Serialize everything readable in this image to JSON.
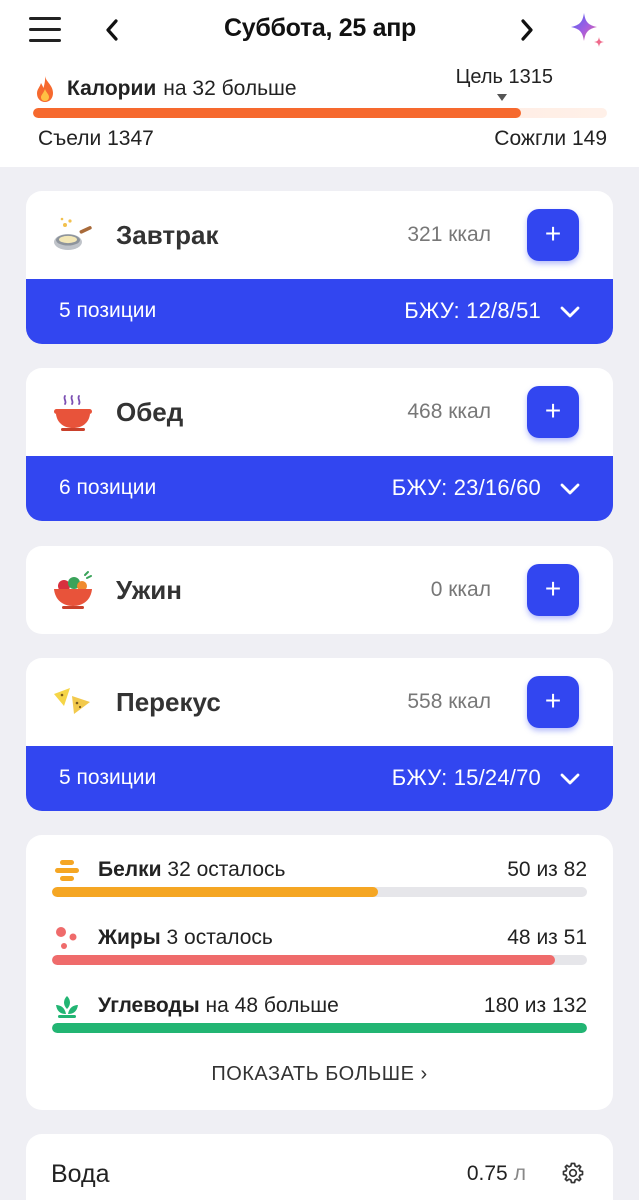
{
  "header": {
    "date": "Суббота, 25 апр"
  },
  "calories": {
    "label": "Калории",
    "status": "на 32 больше",
    "goal": "Цель 1315",
    "eaten": "Съели 1347",
    "burned": "Сожгли 149",
    "progress_fraction": 0.85,
    "goal_marker_fraction": 0.82
  },
  "meals": [
    {
      "name": "Завтрак",
      "kcal": "321 ккал",
      "items": "5 позиции",
      "bju": "БЖУ: 12/8/51",
      "icon": "pan-icon",
      "add": "+"
    },
    {
      "name": "Обед",
      "kcal": "468 ккал",
      "items": "6 позиции",
      "bju": "БЖУ: 23/16/60",
      "icon": "soup-bowl-icon",
      "add": "+"
    },
    {
      "name": "Ужин",
      "kcal": "0 ккал",
      "icon": "salad-bowl-icon",
      "add": "+"
    },
    {
      "name": "Перекус",
      "kcal": "558 ккал",
      "items": "5 позиции",
      "bju": "БЖУ: 15/24/70",
      "icon": "nachos-icon",
      "add": "+"
    }
  ],
  "macros": [
    {
      "name": "Белки",
      "status": "32 осталось",
      "value": "50 из 82",
      "fraction": 0.61,
      "color": "#f5a623",
      "icon": "protein-icon"
    },
    {
      "name": "Жиры",
      "status": "3 осталось",
      "value": "48 из 51",
      "fraction": 0.94,
      "color": "#ef6b6b",
      "icon": "fat-icon"
    },
    {
      "name": "Углеводы",
      "status": "на 48 больше",
      "value": "180 из 132",
      "fraction": 1.0,
      "color": "#22b573",
      "icon": "carbs-icon"
    }
  ],
  "show_more": "ПОКАЗАТЬ БОЛЬШЕ",
  "show_more_chevron": "›",
  "water": {
    "title": "Вода",
    "value": "0.75",
    "unit": "л"
  },
  "colors": {
    "accent": "#3246f0",
    "calorie_bar": "#f6692e"
  }
}
